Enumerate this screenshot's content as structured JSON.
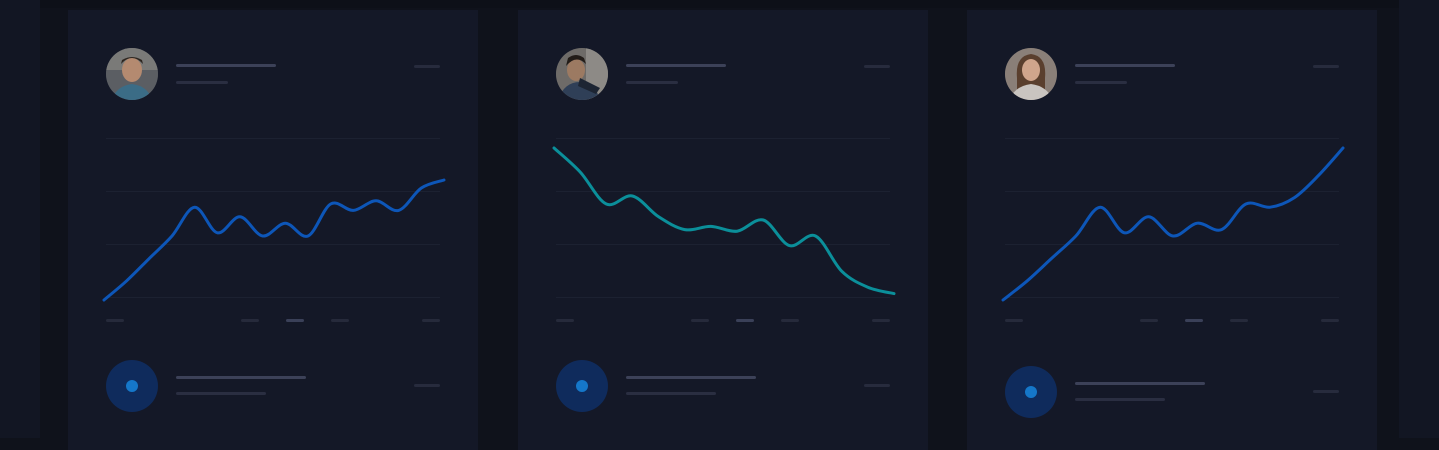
{
  "colors": {
    "background": "#0f121b",
    "card": "#141827",
    "line_blue": "#0d56b8",
    "line_teal": "#0b8f9a",
    "badge": "#0f2b5c",
    "badge_dot": "#1577c9"
  },
  "cards": [
    {
      "avatar_icon": "user-photo-icon",
      "chart_data": {
        "type": "line",
        "series": [
          {
            "values": [
              0,
              12,
              26,
              40,
              58,
              42,
              52,
              40,
              48,
              40,
              60,
              56,
              62,
              56,
              70,
              75
            ]
          }
        ],
        "ylim": [
          0,
          100
        ]
      }
    },
    {
      "avatar_icon": "user-photo-icon",
      "chart_data": {
        "type": "line",
        "series": [
          {
            "values": [
              95,
              80,
              60,
              65,
              52,
              44,
              46,
              43,
              50,
              34,
              40,
              18,
              8,
              4
            ]
          }
        ],
        "ylim": [
          0,
          100
        ]
      }
    },
    {
      "avatar_icon": "user-photo-icon",
      "chart_data": {
        "type": "line",
        "series": [
          {
            "values": [
              0,
              12,
              26,
              40,
              58,
              42,
              52,
              40,
              48,
              44,
              60,
              58,
              64,
              78,
              95
            ]
          }
        ],
        "ylim": [
          0,
          100
        ]
      }
    }
  ]
}
